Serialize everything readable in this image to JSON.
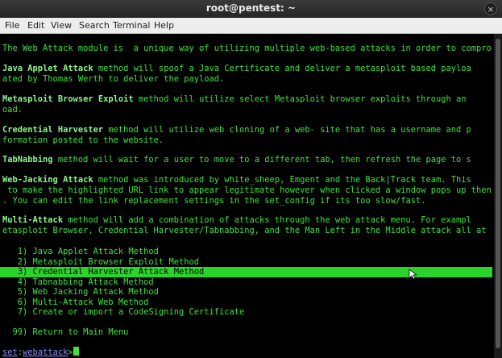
{
  "window": {
    "title": "root@pentest: ~",
    "close_glyph": "×"
  },
  "menu": [
    "File",
    "Edit",
    "View",
    "Search",
    "Terminal",
    "Help"
  ],
  "intro": "The Web Attack module is  a unique way of utilizing multiple web-based attacks in order to compro",
  "methods": [
    {
      "name": "Java Applet Attack",
      "rest1": " method will spoof a Java Certificate and deliver a metasploit based payloa",
      "line2": "ated by Thomas Werth to deliver the payload."
    },
    {
      "name": "Metasploit Browser Exploit",
      "rest1": " method will utilize select Metasploit browser exploits through an",
      "line2": "oad."
    },
    {
      "name": "Credential Harvester",
      "rest1": " method will utilize web cloning of a web- site that has a username and p",
      "line2": "formation posted to the website."
    },
    {
      "name": "TabNabbing",
      "rest1": " method will wait for a user to move to a different tab, then refresh the page to s",
      "line2": ""
    },
    {
      "name": "Web-Jacking Attack",
      "rest1": " method was introduced by white_sheep, Emgent and the Back|Track team. This",
      "line2": " to make the highlighted URL link to appear legitimate however when clicked a window pops up then",
      "line3": ". You can edit the link replacement settings in the set_config if its too slow/fast."
    },
    {
      "name": "Multi-Attack",
      "rest1": " method will add a combination of attacks through the web attack menu. For exampl",
      "line2": "etasploit Browser, Credential Harvester/Tabnabbing, and the Man Left in the Middle attack all at"
    }
  ],
  "options": [
    "   1) Java Applet Attack Method",
    "   2) Metasploit Browser Exploit Method",
    "   3) Credential Harvester Attack Method",
    "   4) Tabnabbing Attack Method",
    "   5) Web Jacking Attack Method",
    "   6) Multi-Attack Web Method",
    "   7) Create or import a CodeSigning Certificate"
  ],
  "return_option": "  99) Return to Main Menu",
  "selected_index": 2,
  "prompt": {
    "set": "set",
    "colon": ":",
    "module": "webattack",
    "arrow": ">"
  }
}
